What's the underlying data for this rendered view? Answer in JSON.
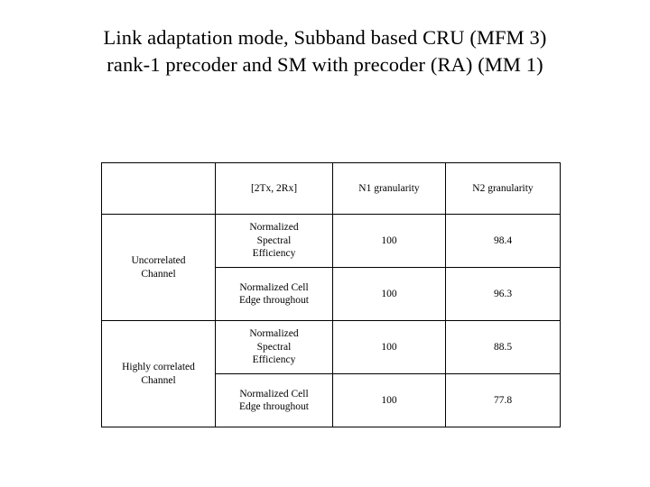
{
  "slide": {
    "title_line_1": "Link adaptation mode, Subband based CRU (MFM 3)",
    "title_line_2": "rank-1 precoder and SM with precoder (RA) (MM 1)",
    "background_color": "#ffffff",
    "text_color": "#000000",
    "border_color": "#000000"
  },
  "table": {
    "headers": {
      "corner": "",
      "antenna_config": "[2Tx, 2Rx]",
      "n1": "N1 granularity",
      "n2": "N2 granularity"
    },
    "row_groups": [
      {
        "label": "Uncorrelated\nChannel",
        "rows": [
          {
            "metric": "Normalized\nSpectral\nEfficiency",
            "n1": "100",
            "n2": "98.4"
          },
          {
            "metric": "Normalized Cell\nEdge throughout",
            "n1": "100",
            "n2": "96.3"
          }
        ]
      },
      {
        "label": "Highly correlated\nChannel",
        "rows": [
          {
            "metric": "Normalized\nSpectral\nEfficiency",
            "n1": "100",
            "n2": "88.5"
          },
          {
            "metric": "Normalized Cell\nEdge throughout",
            "n1": "100",
            "n2": "77.8"
          }
        ]
      }
    ]
  },
  "chart_data": {
    "type": "table",
    "title": "Link adaptation mode, Subband based CRU (MFM 3) rank-1 precoder and SM with precoder (RA) (MM 1)",
    "columns": [
      "[2Tx, 2Rx]",
      "N1 granularity",
      "N2 granularity"
    ],
    "row_labels": [
      "Uncorrelated Channel",
      "Highly correlated Channel"
    ],
    "metrics": [
      "Normalized Spectral Efficiency",
      "Normalized Cell Edge throughout"
    ],
    "rows": [
      {
        "channel": "Uncorrelated Channel",
        "metric": "Normalized Spectral Efficiency",
        "N1 granularity": 100,
        "N2 granularity": 98.4
      },
      {
        "channel": "Uncorrelated Channel",
        "metric": "Normalized Cell Edge throughout",
        "N1 granularity": 100,
        "N2 granularity": 96.3
      },
      {
        "channel": "Highly correlated Channel",
        "metric": "Normalized Spectral Efficiency",
        "N1 granularity": 100,
        "N2 granularity": 88.5
      },
      {
        "channel": "Highly correlated Channel",
        "metric": "Normalized Cell Edge throughout",
        "N1 granularity": 100,
        "N2 granularity": 77.8
      }
    ]
  }
}
